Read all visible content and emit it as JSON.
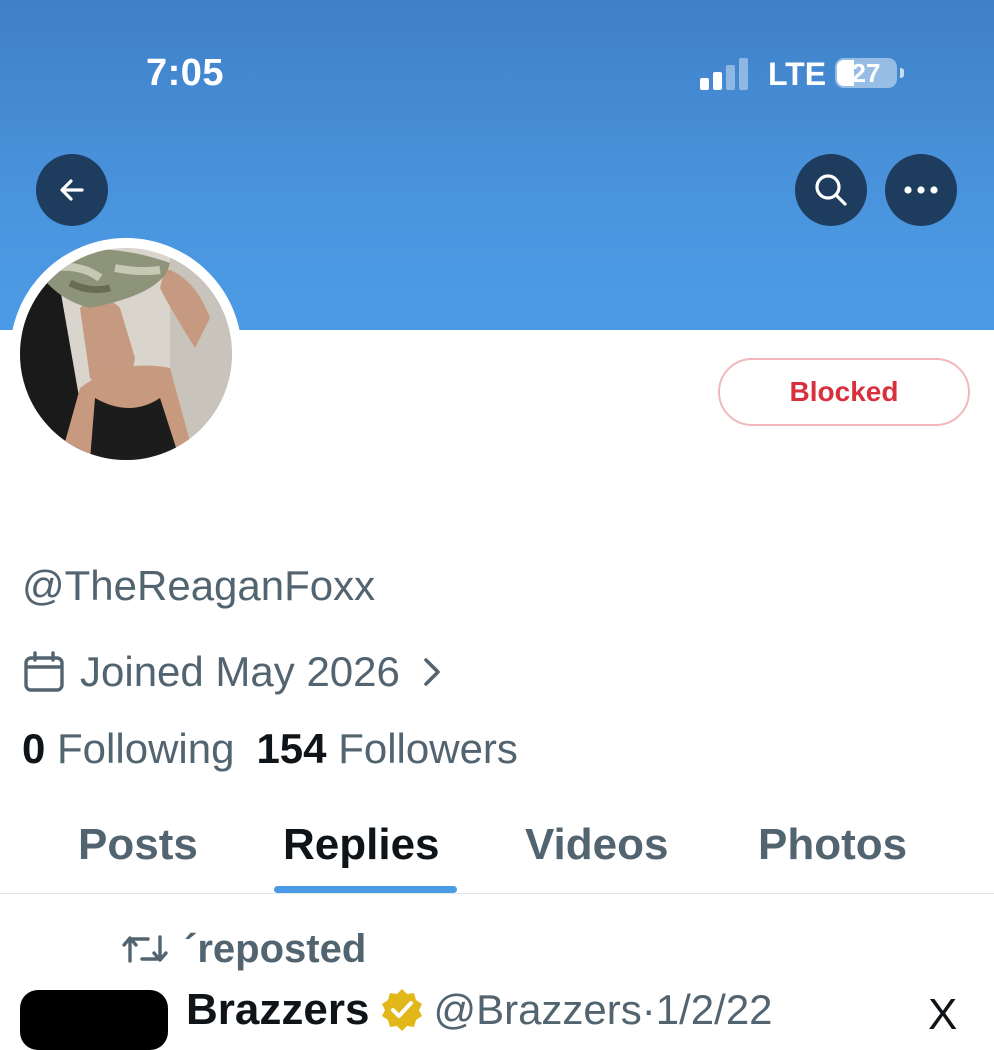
{
  "status_bar": {
    "time": "7:05",
    "network": "LTE",
    "battery": "27"
  },
  "header": {
    "back_icon": "arrow-left-icon",
    "search_icon": "search-icon",
    "more_icon": "more-horizontal-icon",
    "banner_color": "#4a94dd"
  },
  "profile": {
    "blocked_label": "Blocked",
    "handle": "@TheReaganFoxx",
    "joined": "Joined May 2026",
    "following_count": "0",
    "following_label": "Following",
    "followers_count": "154",
    "followers_label": "Followers"
  },
  "tabs": [
    {
      "label": "Posts"
    },
    {
      "label": "Replies",
      "active": true
    },
    {
      "label": "Videos"
    },
    {
      "label": "Photos"
    }
  ],
  "feed": {
    "repost_label": "´reposted",
    "post": {
      "name": "Brazzers",
      "meta": "@Brazzers·1/2/22",
      "x_label": "X"
    }
  },
  "colors": {
    "accent": "#4a9be6",
    "blocked_red": "#d9303d",
    "muted_text": "#536471"
  }
}
